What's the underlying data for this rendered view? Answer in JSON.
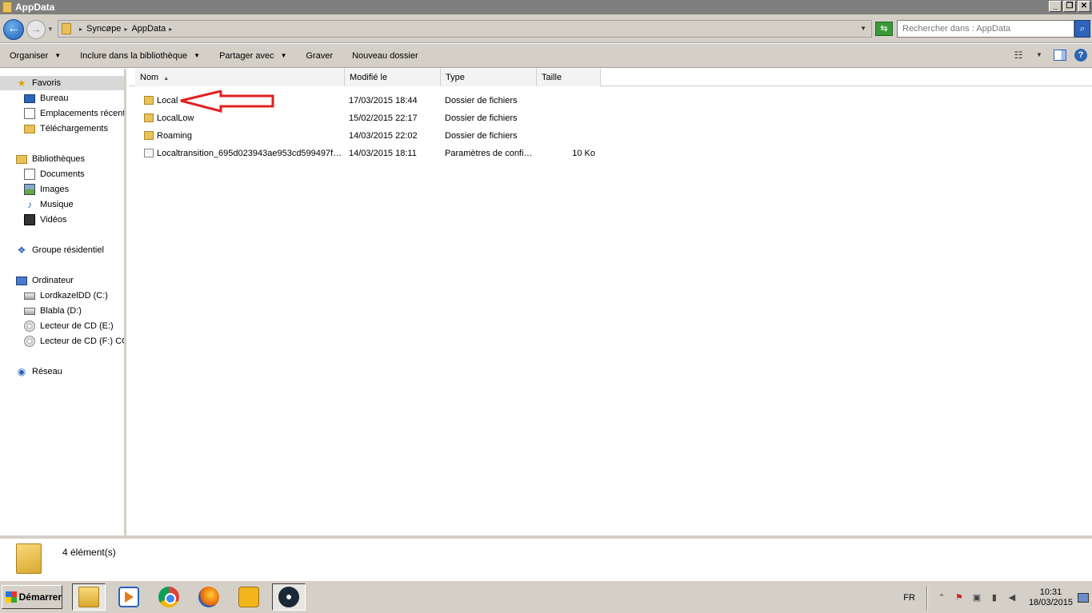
{
  "window": {
    "title": "AppData"
  },
  "address": {
    "crumbs": [
      "Syncøpe",
      "AppData"
    ],
    "search_placeholder": "Rechercher dans : AppData"
  },
  "toolbar": {
    "organize": "Organiser",
    "include": "Inclure dans la bibliothèque",
    "share": "Partager avec",
    "burn": "Graver",
    "new_folder": "Nouveau dossier"
  },
  "nav": {
    "favorites": "Favoris",
    "desktop": "Bureau",
    "recent": "Emplacements récents",
    "downloads": "Téléchargements",
    "libraries": "Bibliothèques",
    "documents": "Documents",
    "images": "Images",
    "music": "Musique",
    "videos": "Vidéos",
    "homegroup": "Groupe résidentiel",
    "computer": "Ordinateur",
    "drive_c": "LordkazelDD (C:)",
    "drive_d": "Blabla (D:)",
    "drive_e": "Lecteur de CD (E:)",
    "drive_f": "Lecteur de CD (F:) CO",
    "network": "Réseau"
  },
  "columns": {
    "name": "Nom",
    "modified": "Modifié le",
    "type": "Type",
    "size": "Taille"
  },
  "files": [
    {
      "name": "Local",
      "modified": "17/03/2015 18:44",
      "type": "Dossier de fichiers",
      "size": ""
    },
    {
      "name": "LocalLow",
      "modified": "15/02/2015 22:17",
      "type": "Dossier de fichiers",
      "size": ""
    },
    {
      "name": "Roaming",
      "modified": "14/03/2015 22:02",
      "type": "Dossier de fichiers",
      "size": ""
    },
    {
      "name": "Localtransition_695d023943ae953cd599497f…",
      "modified": "14/03/2015 18:11",
      "type": "Paramètres de confi…",
      "size": "10 Ko"
    }
  ],
  "status": {
    "count": "4 élément(s)"
  },
  "taskbar": {
    "start": "Démarrer",
    "language": "FR",
    "time": "10:31",
    "date": "18/03/2015"
  },
  "colors": {
    "annotation": "#e02020"
  }
}
